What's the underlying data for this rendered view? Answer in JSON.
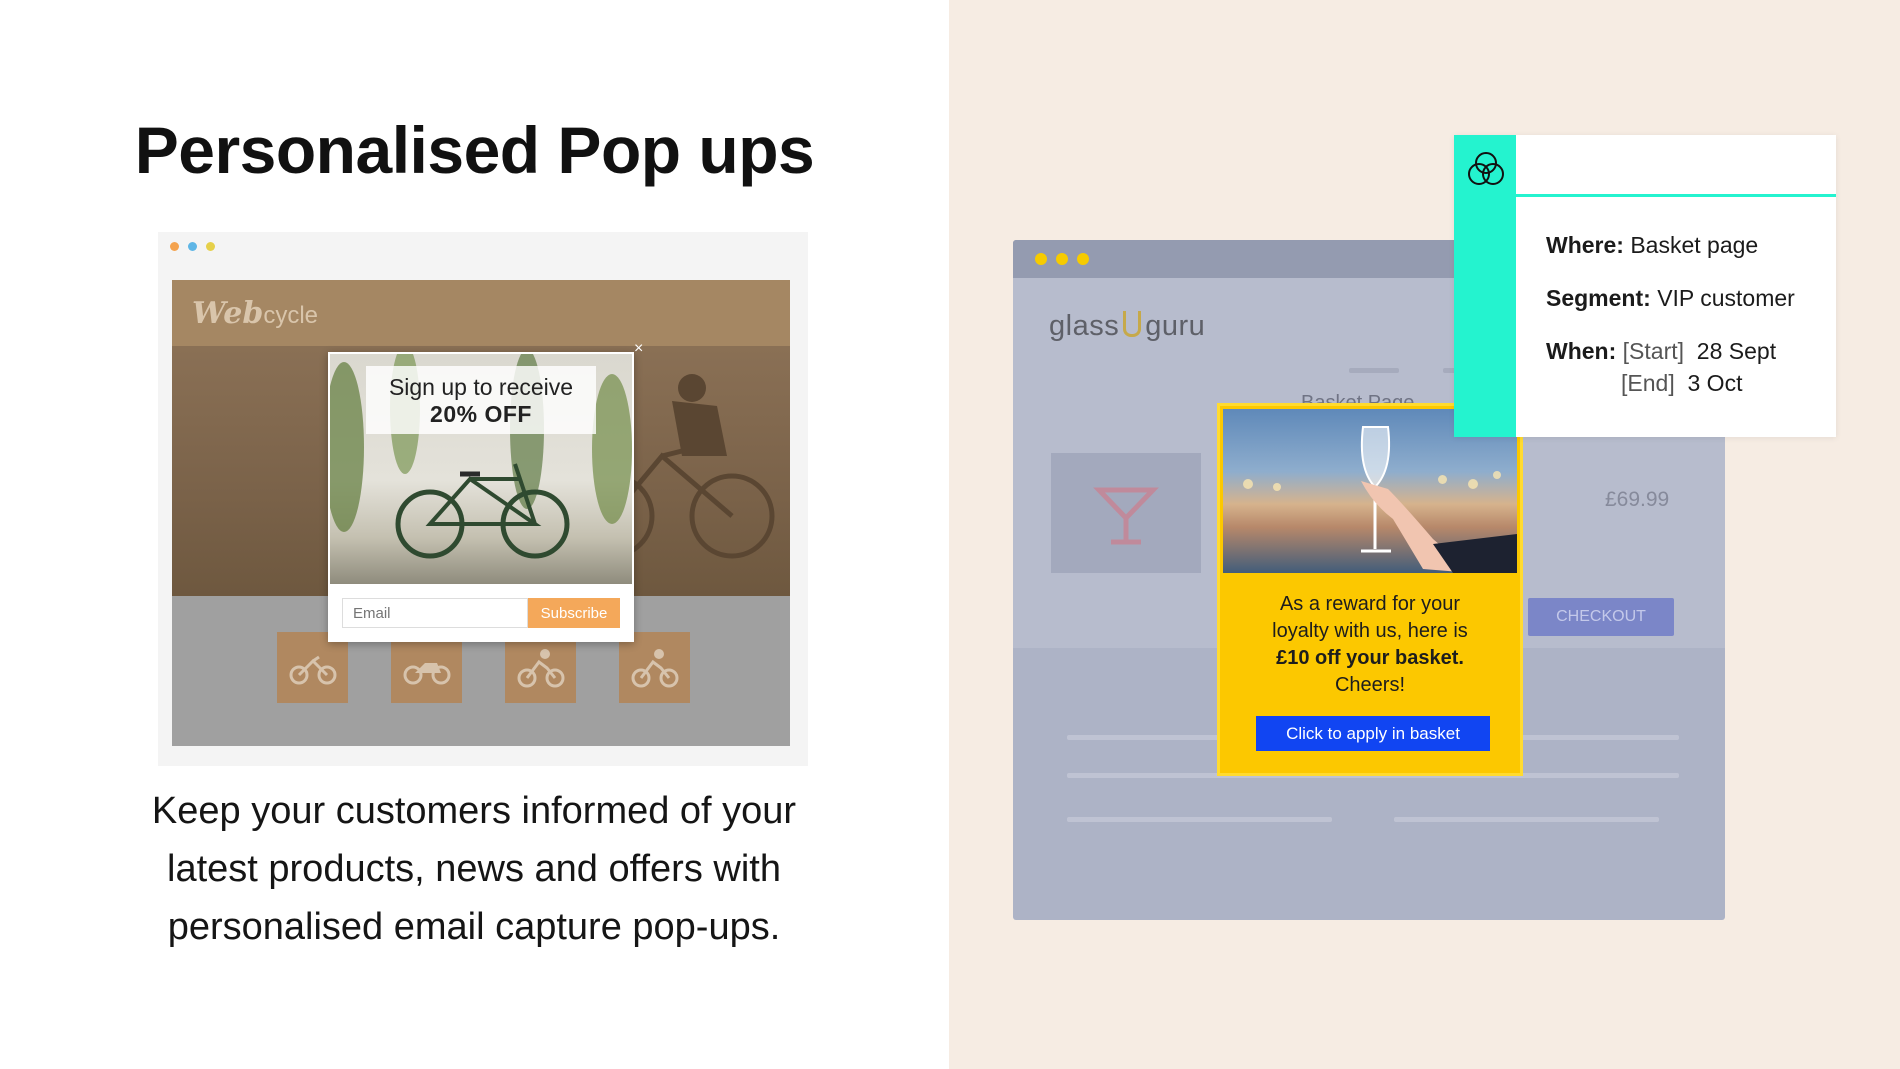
{
  "title": "Personalised Pop ups",
  "description": "Keep your customers informed of your latest products, news and offers with personalised email capture pop-ups.",
  "webcycle": {
    "logo_main": "Web",
    "logo_sub": "cycle",
    "popup": {
      "line1": "Sign up to receive",
      "line2": "20% OFF",
      "close": "×",
      "email_placeholder": "Email",
      "subscribe_label": "Subscribe"
    },
    "icons": [
      "scooter-icon",
      "motorbike-icon",
      "cyclist-icon",
      "cyclist-icon"
    ]
  },
  "glassguru": {
    "logo_left": "glass",
    "logo_right": "guru",
    "page_label": "Basket Page",
    "price": "£69.99",
    "checkout_label": "CHECKOUT",
    "popup": {
      "text_line1": "As a reward for your",
      "text_line2": "loyalty with us, here is",
      "text_bold": "£10 off your basket.",
      "text_line4": "Cheers!",
      "button_label": "Click to apply in basket"
    }
  },
  "rule_card": {
    "where_label": "Where:",
    "where_value": "Basket page",
    "segment_label": "Segment:",
    "segment_value": "VIP customer",
    "when_label": "When:",
    "start_label": "[Start]",
    "start_value": "28 Sept",
    "end_label": "[End]",
    "end_value": "3 Oct"
  },
  "colors": {
    "right_bg": "#f6ece3",
    "accent_teal": "#24f3cf",
    "popup_yellow": "#fcc800",
    "apply_blue": "#1145f2",
    "subscribe_orange": "#f4a85a"
  }
}
